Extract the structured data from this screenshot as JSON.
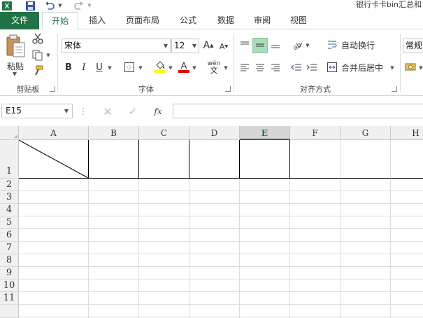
{
  "title_bar": {
    "document_title": "银行卡卡bin汇总和",
    "quick_access": [
      "excel-logo-icon",
      "save-icon",
      "undo-icon",
      "redo-icon"
    ]
  },
  "tabs": [
    {
      "label": "文件",
      "kind": "file"
    },
    {
      "label": "开始",
      "kind": "active"
    },
    {
      "label": "插入"
    },
    {
      "label": "页面布局"
    },
    {
      "label": "公式"
    },
    {
      "label": "数据"
    },
    {
      "label": "审阅"
    },
    {
      "label": "视图"
    }
  ],
  "ribbon": {
    "clipboard": {
      "paste_label": "粘贴",
      "group_label": "剪贴板"
    },
    "font": {
      "font_name": "宋体",
      "font_size": "12",
      "bold": "B",
      "italic": "I",
      "underline": "U",
      "grow": "A",
      "shrink": "A",
      "phonetic": "wén",
      "group_label": "字体"
    },
    "alignment": {
      "wrap_text": "自动换行",
      "merge_center": "合并后居中",
      "group_label": "对齐方式"
    },
    "number": {
      "format": "常规"
    }
  },
  "formula_bar": {
    "name_box": "E15",
    "fx_label": "fx",
    "formula_value": ""
  },
  "grid": {
    "columns": [
      "A",
      "B",
      "C",
      "D",
      "E",
      "F",
      "G",
      "H"
    ],
    "selected_column": "E",
    "rows": [
      "1",
      "2",
      "3",
      "4",
      "5",
      "6",
      "7",
      "8",
      "9",
      "10",
      "11"
    ]
  },
  "colors": {
    "accent": "#217346",
    "font_color": "#e00000",
    "fill_color": "#ffff00"
  }
}
